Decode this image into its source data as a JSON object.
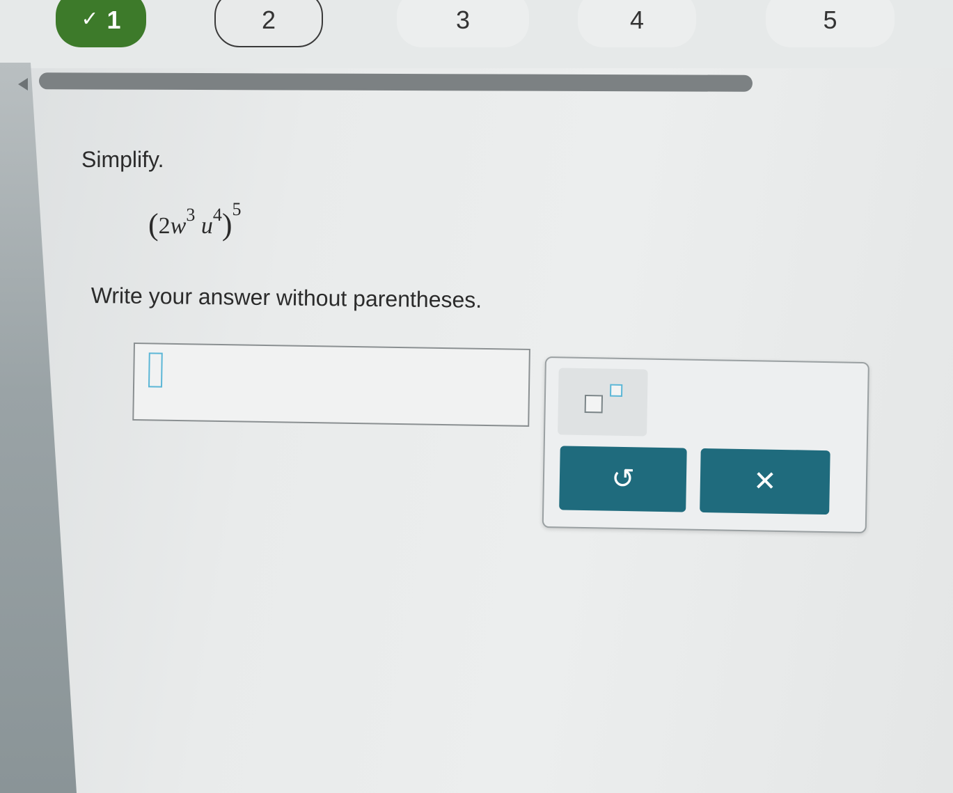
{
  "steps": [
    {
      "label": "1",
      "status": "completed",
      "icon": "check-icon"
    },
    {
      "label": "2",
      "status": "current"
    },
    {
      "label": "3",
      "status": "upcoming"
    },
    {
      "label": "4",
      "status": "upcoming"
    },
    {
      "label": "5",
      "status": "upcoming"
    }
  ],
  "question": {
    "instruction": "Simplify.",
    "expression": {
      "open_paren": "(",
      "coefficient": "2",
      "var1": "w",
      "exp1": "3",
      "var2": "u",
      "exp2": "4",
      "close_paren": ")",
      "outer_exp": "5"
    },
    "note": "Write your answer without parentheses."
  },
  "answer": {
    "value": ""
  },
  "toolbar": {
    "exponent_button": "superscript-template-icon",
    "undo_button": {
      "glyph": "↺",
      "icon": "undo-icon"
    },
    "clear_button": {
      "glyph": "✕",
      "icon": "clear-icon"
    }
  },
  "colors": {
    "completed_step": "#3d7a2a",
    "action_button": "#1f6b7d",
    "input_cursor": "#5bb6d6"
  }
}
